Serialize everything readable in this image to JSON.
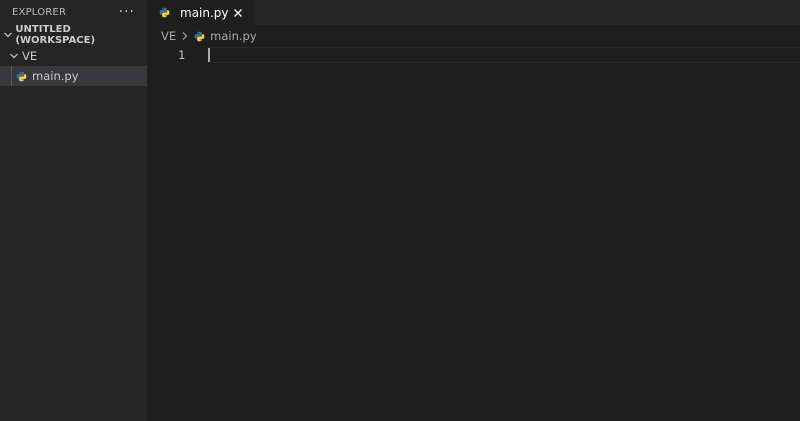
{
  "sidebar": {
    "title": "EXPLORER",
    "more_icon": "ellipsis-icon",
    "workspace": {
      "label": "UNTITLED (WORKSPACE)",
      "expanded": true
    },
    "folder": {
      "label": "VE",
      "expanded": true
    },
    "files": [
      {
        "label": "main.py",
        "icon": "python-file-icon",
        "selected": true
      }
    ]
  },
  "editor": {
    "tabs": [
      {
        "label": "main.py",
        "icon": "python-file-icon",
        "active": true,
        "close_icon": "close-icon"
      }
    ],
    "breadcrumb": [
      "VE",
      "main.py"
    ],
    "lines": [
      {
        "number": "1",
        "text": ""
      }
    ]
  },
  "colors": {
    "sidebar_bg": "#252526",
    "editor_bg": "#1e1e1e",
    "selected_row_bg": "#37373d",
    "python_blue": "#3572A5",
    "python_yellow": "#FFD43B"
  }
}
